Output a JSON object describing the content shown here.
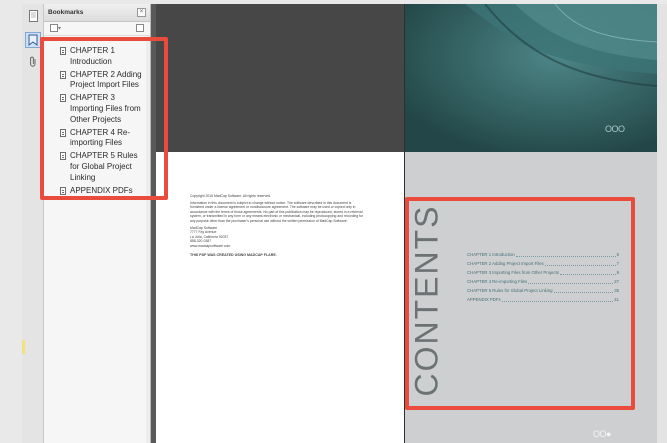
{
  "bookmarks_panel": {
    "title": "Bookmarks",
    "close_glyph": "×",
    "items": [
      {
        "label": "CHAPTER 1 Introduction"
      },
      {
        "label": "CHAPTER 2 Adding Project Import Files"
      },
      {
        "label": "CHAPTER 3 Importing Files from Other Projects"
      },
      {
        "label": "CHAPTER 4 Re-importing Files"
      },
      {
        "label": "CHAPTER 5 Rules for Global Project Linking"
      },
      {
        "label": "APPENDIX   PDFs"
      }
    ]
  },
  "toolstrip": {
    "icons": [
      "pages-panel-icon",
      "bookmarks-panel-icon",
      "attachments-paperclip-icon"
    ]
  },
  "document": {
    "copyright": {
      "line1": "Copyright 2016 MadCap Software. All rights reserved.",
      "para": "Information in this document is subject to change without notice. The software described in this document is furnished under a license agreement or nondisclosure agreement. The software may be used or copied only in accordance with the terms of those agreements. No part of this publication may be reproduced, stored in a retrieval system, or transmitted in any form or any means electronic or mechanical, including photocopying and recording for any purpose other than the purchaser's personal use without the written permission of MadCap Software.",
      "address": [
        "MadCap Software",
        "7777 Fay Avenue",
        "La Jolla, California 92037",
        "858-320-0387",
        "www.madcapsoftware.com"
      ],
      "created_by": "THIS PDF WAS CREATED USING MADCAP FLARE."
    },
    "contents_heading": "CONTENTS",
    "toc": [
      {
        "title": "CHAPTER 1 Introduction",
        "page": "5"
      },
      {
        "title": "CHAPTER 2 Adding Project Import Files",
        "page": "7"
      },
      {
        "title": "CHAPTER 3 Importing Files from Other Projects",
        "page": "9"
      },
      {
        "title": "CHAPTER 4 Re-importing Files",
        "page": "27"
      },
      {
        "title": "CHAPTER 5 Rules for Global Project Linking",
        "page": "35"
      },
      {
        "title": "APPENDIX   PDFs",
        "page": "41"
      }
    ],
    "decor_top": "OOO",
    "decor_bottom": "OO●"
  },
  "colors": {
    "highlight": "#e94b3c",
    "teal": "#2f5b5c",
    "toc_text": "#496f7a"
  }
}
